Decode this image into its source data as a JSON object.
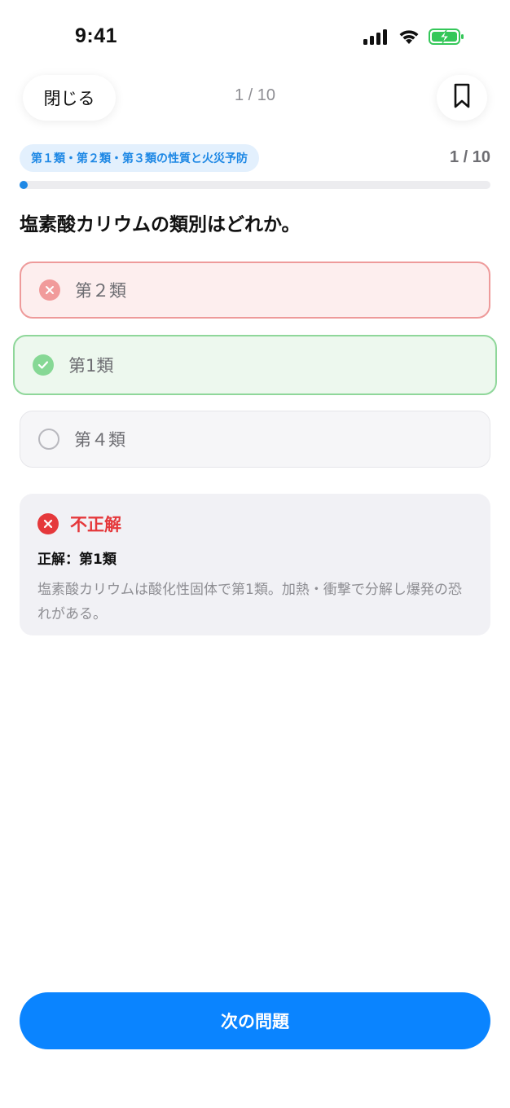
{
  "status_bar": {
    "time": "9:41",
    "icons": [
      "signal-icon",
      "wifi-icon",
      "battery-charging-icon"
    ]
  },
  "header": {
    "close_label": "閉じる",
    "counter": "1 / 10",
    "bookmark_icon": "bookmark-icon"
  },
  "quiz": {
    "category": "第１類・第２類・第３類の性質と火災予防",
    "progress_text": "1 / 10",
    "progress_fraction": 0.1,
    "question": "塩素酸カリウムの類別はどれか。",
    "options": [
      {
        "label": "第２類",
        "state": "wrong"
      },
      {
        "label": "第1類",
        "state": "correct"
      },
      {
        "label": "第４類",
        "state": "neutral"
      }
    ]
  },
  "result": {
    "title": "不正解",
    "answer_line": "正解：第1類",
    "explanation": "塩素酸カリウムは酸化性固体で第1類。加熱・衝撃で分解し爆発の恐れがある。"
  },
  "footer": {
    "next_label": "次の問題"
  },
  "colors": {
    "accent": "#0a84ff",
    "progress": "#1e88e5",
    "wrong": "#e5383b",
    "correct": "#86d895"
  }
}
